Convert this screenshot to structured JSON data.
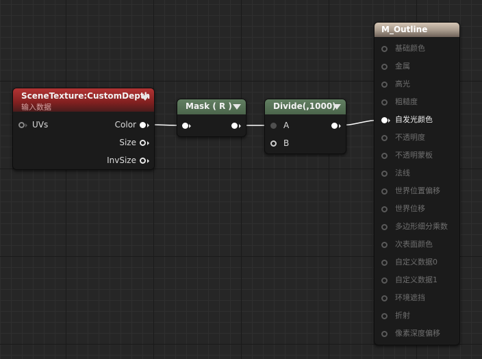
{
  "nodes": {
    "scene_texture": {
      "title": "SceneTexture:CustomDepth",
      "subtitle": "输入数据",
      "inputs": [
        "UVs"
      ],
      "outputs": [
        "Color",
        "Size",
        "InvSize"
      ]
    },
    "mask": {
      "title": "Mask ( R )"
    },
    "divide": {
      "title": "Divide(,1000)",
      "inputs": [
        "A",
        "B"
      ]
    },
    "material": {
      "title": "M_Outline",
      "pins": [
        "基础颜色",
        "金属",
        "高光",
        "粗糙度",
        "自发光颜色",
        "不透明度",
        "不透明蒙板",
        "法线",
        "世界位置偏移",
        "世界位移",
        "多边形细分乘数",
        "次表面颜色",
        "自定义数据0",
        "自定义数据1",
        "环境遮挡",
        "折射",
        "像素深度偏移"
      ],
      "active_pin": "自发光颜色"
    }
  },
  "colors": {
    "background": "#262626",
    "scene_texture_header": "#822020",
    "math_header": "#4c654c",
    "material_header": "#a6988a",
    "wire": "#ffffff"
  },
  "icons": [
    "collapse-arrow-icon",
    "pin-circle-icon"
  ]
}
